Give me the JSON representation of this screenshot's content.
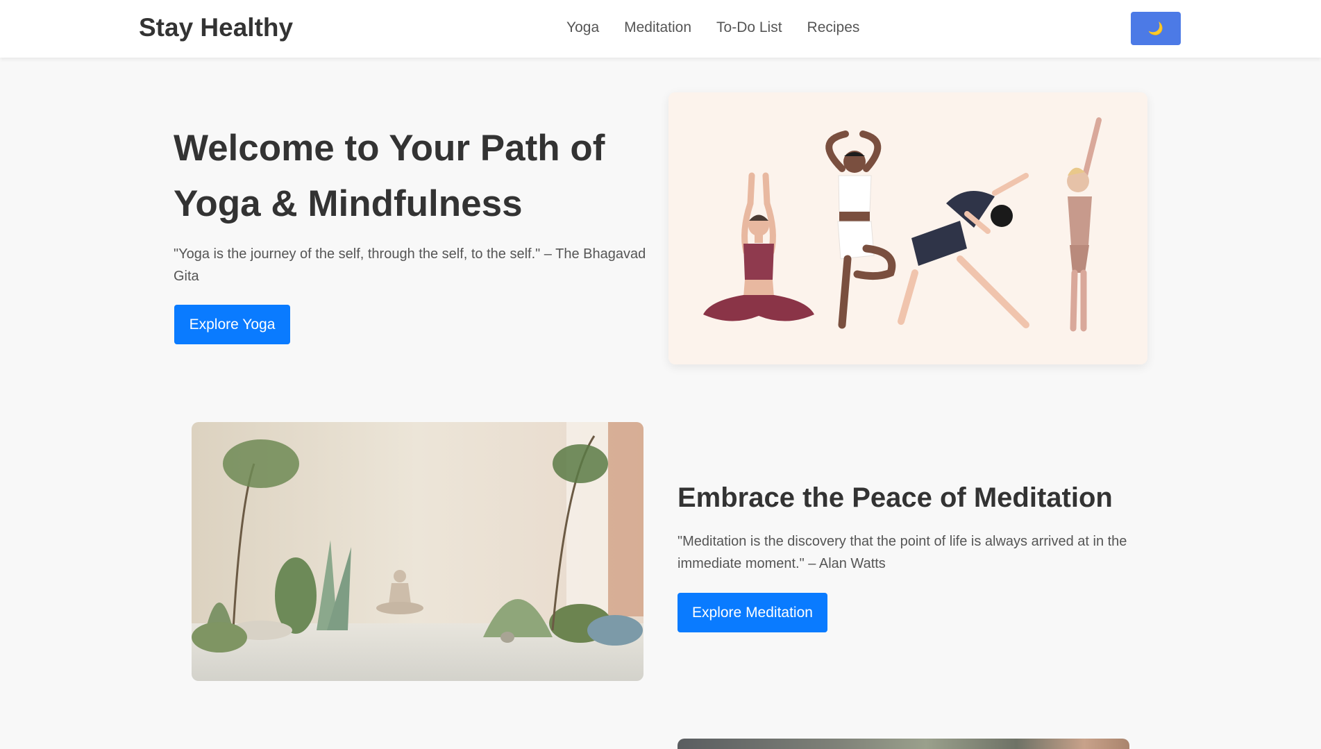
{
  "header": {
    "brand": "Stay Healthy",
    "nav": [
      {
        "label": "Yoga"
      },
      {
        "label": "Meditation"
      },
      {
        "label": "To-Do List"
      },
      {
        "label": "Recipes"
      }
    ],
    "theme_toggle_icon": "moon-icon",
    "theme_toggle_glyph": "🌙"
  },
  "hero": {
    "title": "Welcome to Your Path of Yoga & Mindfulness",
    "quote": "\"Yoga is the journey of the self, through the self, to the self.\" – The Bhagavad Gita",
    "button": "Explore Yoga"
  },
  "meditation": {
    "title": "Embrace the Peace of Meditation",
    "quote": "\"Meditation is the discovery that the point of life is always arrived at in the immediate moment.\" – Alan Watts",
    "button": "Explore Meditation"
  },
  "colors": {
    "primary": "#0a7bff",
    "toggle": "#4c7ae6",
    "background": "#f8f8f8",
    "card": "#fcf3ec"
  }
}
